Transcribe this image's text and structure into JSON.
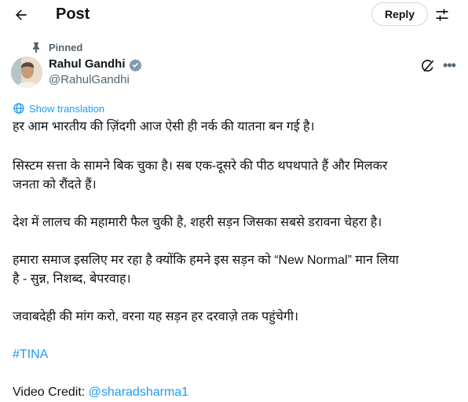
{
  "header": {
    "title": "Post",
    "reply_label": "Reply"
  },
  "pinned_label": "Pinned",
  "author": {
    "name": "Rahul Gandhi",
    "handle": "@RahulGandhi"
  },
  "translate_label": "Show translation",
  "post": {
    "p1": "हर आम भारतीय की ज़िंदगी आज ऐसी ही नर्क की यातना बन गई है।",
    "p2_line1": "सिस्टम सत्ता के सामने बिक चुका है। सब एक-दूसरे की पीठ थपथपाते हैं और मिलकर",
    "p2_line2": "जनता को रौंदते हैं।",
    "p3": "देश में लालच की महामारी फैल चुकी है, शहरी सड़न जिसका सबसे डरावना चेहरा है।",
    "p4_line1": "हमारा समाज इसलिए मर रहा है क्योंकि हमने इस सड़न को “New Normal” मान लिया",
    "p4_line2": "है - सुन्न, निशब्द, बेपरवाह।",
    "p5": "जवाबदेही की मांग करो, वरना यह सड़न हर दरवाज़े तक पहुंचेगी।",
    "hashtag": "#TINA",
    "credit_prefix": "Video Credit: ",
    "credit_handle": "@sharadsharma1"
  },
  "colors": {
    "link": "#1d9bf0",
    "verified": "#829aab",
    "muted": "#536471"
  },
  "icons": [
    "back-arrow-icon",
    "settings-sliders-icon",
    "pin-icon",
    "verified-badge-icon",
    "grok-icon",
    "more-icon",
    "translate-icon"
  ]
}
